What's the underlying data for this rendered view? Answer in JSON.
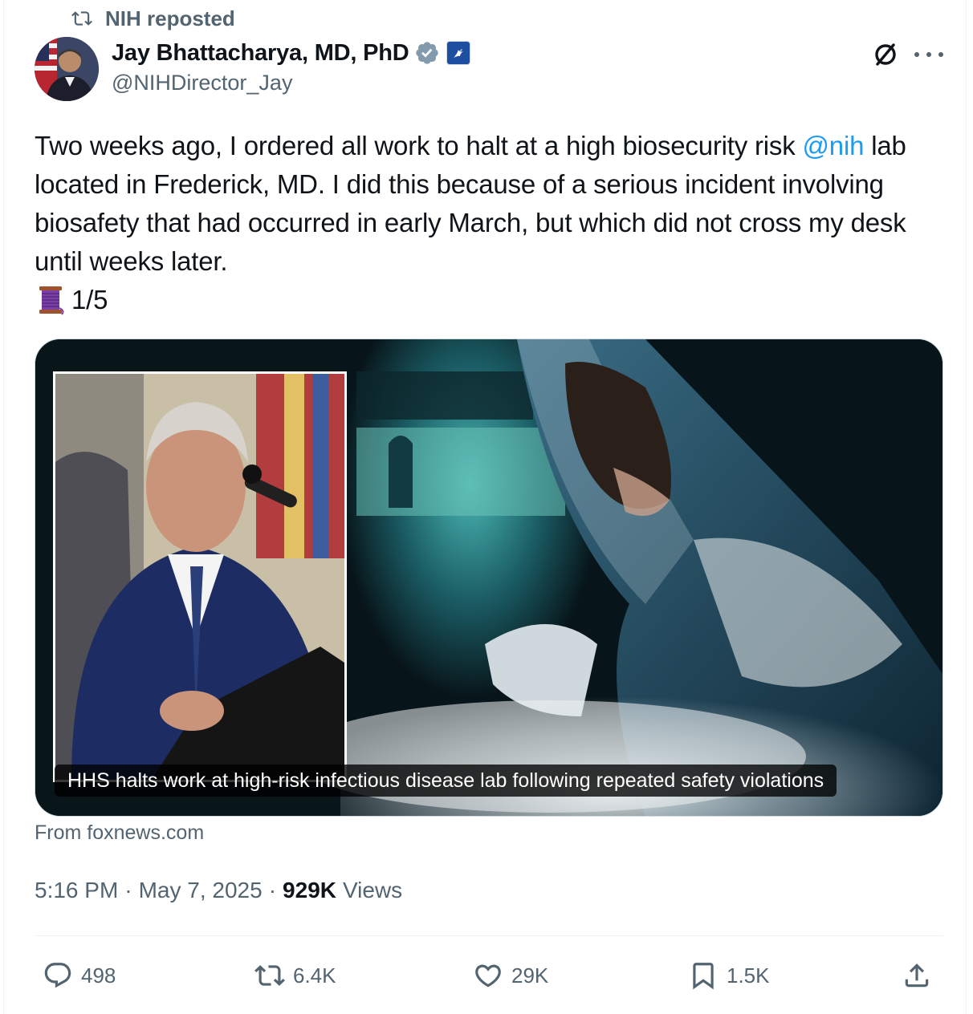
{
  "repost": {
    "label": "NIH reposted"
  },
  "author": {
    "display_name": "Jay Bhattacharya, MD, PhD",
    "handle": "@NIHDirector_Jay"
  },
  "tweet": {
    "text_1": "Two weeks ago, I ordered all work to halt at a high biosecurity risk ",
    "mention": "@nih",
    "text_2": " lab located in Frederick, MD. I did this because of a serious incident involving biosafety that had occurred in early March, but which did not cross my desk until weeks later.",
    "thread_count": "1/5"
  },
  "link_card": {
    "caption": "HHS halts work at high-risk infectious disease lab following repeated safety violations",
    "source": "From foxnews.com"
  },
  "meta": {
    "time": "5:16 PM",
    "separator": "·",
    "date": "May 7, 2025",
    "views_count": "929K",
    "views_label": "Views"
  },
  "actions": {
    "replies": "498",
    "reposts": "6.4K",
    "likes": "29K",
    "bookmarks": "1.5K"
  },
  "colors": {
    "text_primary": "#0f1419",
    "text_secondary": "#536471",
    "link": "#1d9bf0",
    "verified": "#829aab",
    "border": "#eff3f4"
  },
  "icons": [
    "repost-icon",
    "verified-badge-icon",
    "affiliation-badge-icon",
    "grok-icon",
    "more-icon",
    "spool-emoji-icon",
    "reply-icon",
    "retweet-icon",
    "like-icon",
    "bookmark-icon",
    "share-icon"
  ]
}
